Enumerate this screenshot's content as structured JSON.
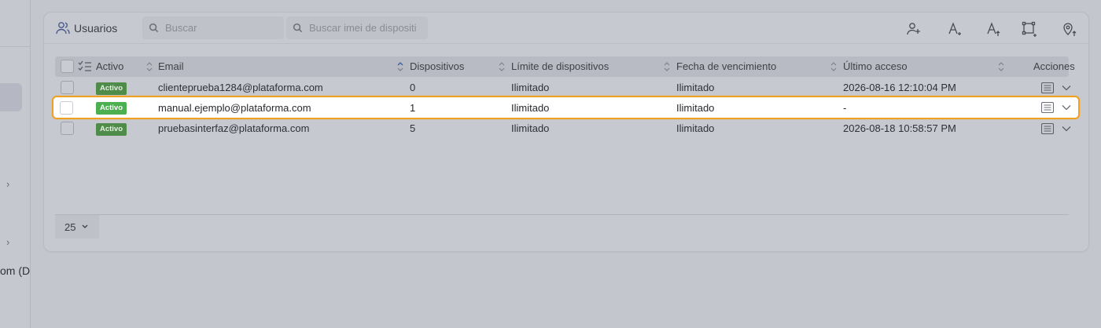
{
  "sidebar": {
    "partial_label": "om (D"
  },
  "header": {
    "title": "Usuarios",
    "search_users_placeholder": "Buscar",
    "search_imei_placeholder": "Buscar imei de dispositi",
    "toolbar_icons": [
      "add-user-icon",
      "font-increase-icon",
      "font-sort-icon",
      "crop-area-icon",
      "map-pin-icon"
    ]
  },
  "table": {
    "columns": {
      "status": "Activo",
      "email": "Email",
      "devices": "Dispositivos",
      "device_limit": "Límite de dispositivos",
      "expiry": "Fecha de vencimiento",
      "last_access": "Último acceso",
      "actions": "Acciones"
    },
    "rows": [
      {
        "status": "Activo",
        "email": "clienteprueba1284@plataforma.com",
        "devices": "0",
        "device_limit": "Ilimitado",
        "expiry": "Ilimitado",
        "last_access": "2026-08-16 12:10:04 PM"
      },
      {
        "status": "Activo",
        "email": "manual.ejemplo@plataforma.com",
        "devices": "1",
        "device_limit": "Ilimitado",
        "expiry": "Ilimitado",
        "last_access": "-"
      },
      {
        "status": "Activo",
        "email": "pruebasinterfaz@plataforma.com",
        "devices": "5",
        "device_limit": "Ilimitado",
        "expiry": "Ilimitado",
        "last_access": "2026-08-18 10:58:57 PM"
      }
    ]
  },
  "pagination": {
    "page_size": "25"
  },
  "colors": {
    "highlight_border": "#f0a11f",
    "badge_green": "#4caf50"
  }
}
